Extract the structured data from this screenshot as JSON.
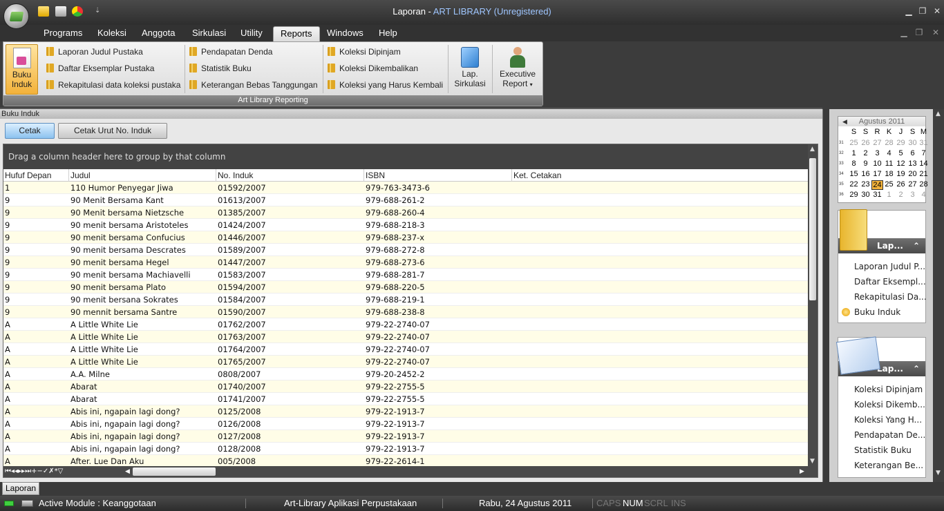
{
  "window": {
    "title_app": "Laporan - ",
    "title_name": "ART LIBRARY (Unregistered)"
  },
  "menu": {
    "tabs": [
      "Programs",
      "Koleksi",
      "Anggota",
      "Sirkulasi",
      "Utility",
      "Reports",
      "Windows",
      "Help"
    ],
    "active": "Reports"
  },
  "ribbon": {
    "buku_induk_line1": "Buku",
    "buku_induk_line2": "Induk",
    "col1": [
      "Laporan Judul Pustaka",
      "Daftar Eksemplar Pustaka",
      "Rekapitulasi data koleksi pustaka"
    ],
    "col2": [
      "Pendapatan Denda",
      "Statistik Buku",
      "Keterangan Bebas Tanggungan"
    ],
    "col3": [
      "Koleksi Dipinjam",
      "Koleksi Dikembalikan",
      "Koleksi yang Harus Kembali"
    ],
    "lap_line1": "Lap.",
    "lap_line2": "Sirkulasi",
    "exec_line1": "Executive",
    "exec_line2": "Report",
    "group_caption": "Art Library Reporting"
  },
  "doc": {
    "title": "Buku Induk",
    "cetak": "Cetak",
    "cetak_urut": "Cetak Urut No. Induk",
    "group_hint": "Drag a column header here to group by that column"
  },
  "grid": {
    "columns": [
      "Hufuf Depan",
      "Judul",
      "No. Induk",
      "ISBN",
      "Ket. Cetakan"
    ],
    "rows": [
      [
        "1",
        "110 Humor Penyegar Jiwa",
        "01592/2007",
        "979-763-3473-6",
        ""
      ],
      [
        "9",
        "90 Menit Bersama Kant",
        "01613/2007",
        "979-688-261-2",
        ""
      ],
      [
        "9",
        "90 Menit bersama Nietzsche",
        "01385/2007",
        "979-688-260-4",
        ""
      ],
      [
        "9",
        "90 menit bersama Aristoteles",
        "01424/2007",
        "979-688-218-3",
        ""
      ],
      [
        "9",
        "90 menit bersama Confucius",
        "01446/2007",
        "979-688-237-x",
        ""
      ],
      [
        "9",
        "90 menit bersama Descrates",
        "01589/2007",
        "979-688-272-8",
        ""
      ],
      [
        "9",
        "90 menit bersama Hegel",
        "01447/2007",
        "979-688-273-6",
        ""
      ],
      [
        "9",
        "90 menit bersama Machiavelli",
        "01583/2007",
        "979-688-281-7",
        ""
      ],
      [
        "9",
        "90 menit bersama Plato",
        "01594/2007",
        "979-688-220-5",
        ""
      ],
      [
        "9",
        "90 menit bersana Sokrates",
        "01584/2007",
        "979-688-219-1",
        ""
      ],
      [
        "9",
        "90 mennit bersama Santre",
        "01590/2007",
        "979-688-238-8",
        ""
      ],
      [
        "A",
        " A Little White Lie",
        "01762/2007",
        "979-22-2740-07",
        ""
      ],
      [
        "A",
        " A Little White Lie",
        "01763/2007",
        "979-22-2740-07",
        ""
      ],
      [
        "A",
        " A Little White Lie",
        "01764/2007",
        "979-22-2740-07",
        ""
      ],
      [
        "A",
        " A Little White Lie",
        "01765/2007",
        "979-22-2740-07",
        ""
      ],
      [
        "A",
        "A.A. Milne",
        "0808/2007",
        "979-20-2452-2",
        ""
      ],
      [
        "A",
        "Abarat",
        "01740/2007",
        "979-22-2755-5",
        ""
      ],
      [
        "A",
        "Abarat",
        "01741/2007",
        "979-22-2755-5",
        ""
      ],
      [
        "A",
        "Abis ini, ngapain lagi dong?",
        "0125/2008",
        "979-22-1913-7",
        ""
      ],
      [
        "A",
        "Abis ini, ngapain lagi dong?",
        "0126/2008",
        "979-22-1913-7",
        ""
      ],
      [
        "A",
        "Abis ini, ngapain lagi dong?",
        "0127/2008",
        "979-22-1913-7",
        ""
      ],
      [
        "A",
        "Abis ini, ngapain lagi dong?",
        "0128/2008",
        "979-22-1913-7",
        ""
      ],
      [
        "A",
        "After. Lue Dan Aku",
        "005/2008",
        "979-22-2614-1",
        ""
      ]
    ],
    "nav_glyphs": "⏮◂◂▸▸⏭+−✓✗*▽"
  },
  "calendar": {
    "month": "Agustus 2011",
    "weekdays": [
      "S",
      "S",
      "R",
      "K",
      "J",
      "S",
      "M"
    ],
    "weeks": [
      {
        "wk": "31",
        "days": [
          "25",
          "26",
          "27",
          "28",
          "29",
          "30",
          "31"
        ]
      },
      {
        "wk": "32",
        "days": [
          "1",
          "2",
          "3",
          "4",
          "5",
          "6",
          "7"
        ]
      },
      {
        "wk": "33",
        "days": [
          "8",
          "9",
          "10",
          "11",
          "12",
          "13",
          "14"
        ]
      },
      {
        "wk": "34",
        "days": [
          "15",
          "16",
          "17",
          "18",
          "19",
          "20",
          "21"
        ]
      },
      {
        "wk": "35",
        "days": [
          "22",
          "23",
          "24",
          "25",
          "26",
          "27",
          "28"
        ]
      },
      {
        "wk": "36",
        "days": [
          "29",
          "30",
          "31",
          "1",
          "2",
          "3",
          "4"
        ]
      }
    ],
    "today": "24"
  },
  "box1": {
    "header": "Lap...",
    "items": [
      "Laporan Judul P...",
      "Daftar Eksempl...",
      "Rekapitulasi Da...",
      "Buku Induk"
    ]
  },
  "box2": {
    "header": "Lap...",
    "items": [
      "Koleksi Dipinjam",
      "Koleksi Dikemb...",
      "Koleksi Yang H...",
      "Pendapatan De...",
      "Statistik Buku",
      "Keterangan Be..."
    ]
  },
  "doctab": "Laporan",
  "status": {
    "module": "Active Module : Keanggotaan",
    "app": "Art-Library Aplikasi Perpustakaan",
    "date": "Rabu, 24 Agustus 2011",
    "caps": "CAPS",
    "num": "NUM",
    "scrl": "SCRL",
    "ins": "INS"
  },
  "colors": {
    "accent": "#f3b23a",
    "row_alt": "#fffde7",
    "title_reg": "#9fc6ff"
  }
}
